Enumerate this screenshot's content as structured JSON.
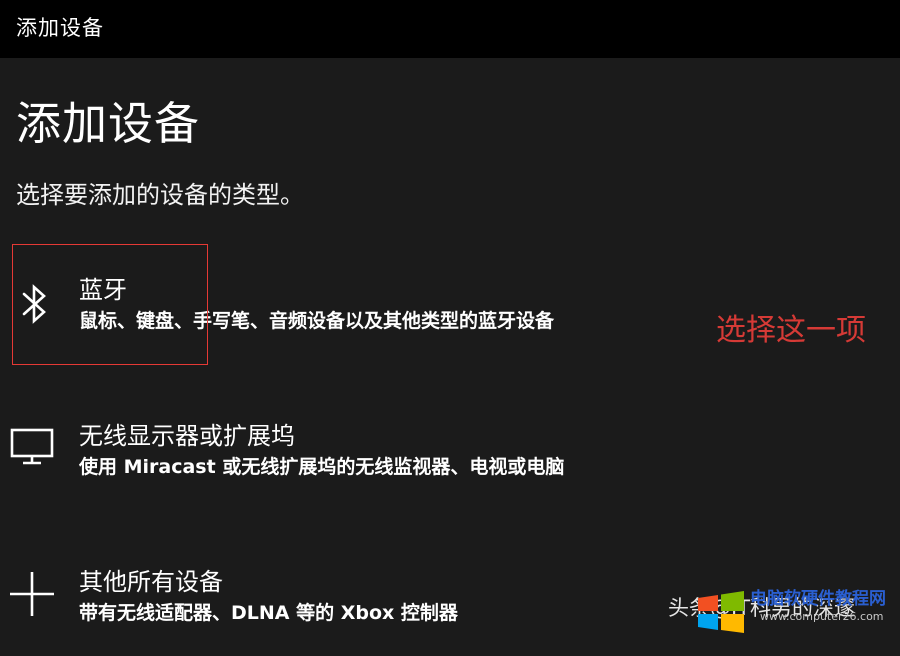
{
  "window": {
    "title": "添加设备"
  },
  "page": {
    "title": "添加设备",
    "subtitle": "选择要添加的设备的类型。"
  },
  "options": [
    {
      "label": "蓝牙",
      "description": "鼠标、键盘、手写笔、音频设备以及其他类型的蓝牙设备",
      "icon": "bluetooth-icon"
    },
    {
      "label": "无线显示器或扩展坞",
      "description": "使用 Miracast 或无线扩展坞的无线监视器、电视或电脑",
      "icon": "monitor-icon"
    },
    {
      "label": "其他所有设备",
      "description": "带有无线适配器、DLNA 等的 Xbox 控制器",
      "icon": "plus-icon"
    }
  ],
  "annotation": {
    "text": "选择这一项",
    "color": "#d63a36"
  },
  "watermark": {
    "text": "头条@IT科男的深邃",
    "site": "电脑软硬件教程网",
    "url": "www.computer26.com"
  },
  "colors": {
    "background": "#1b1b1b",
    "titlebar": "#000000",
    "highlight_border": "#e53935"
  }
}
